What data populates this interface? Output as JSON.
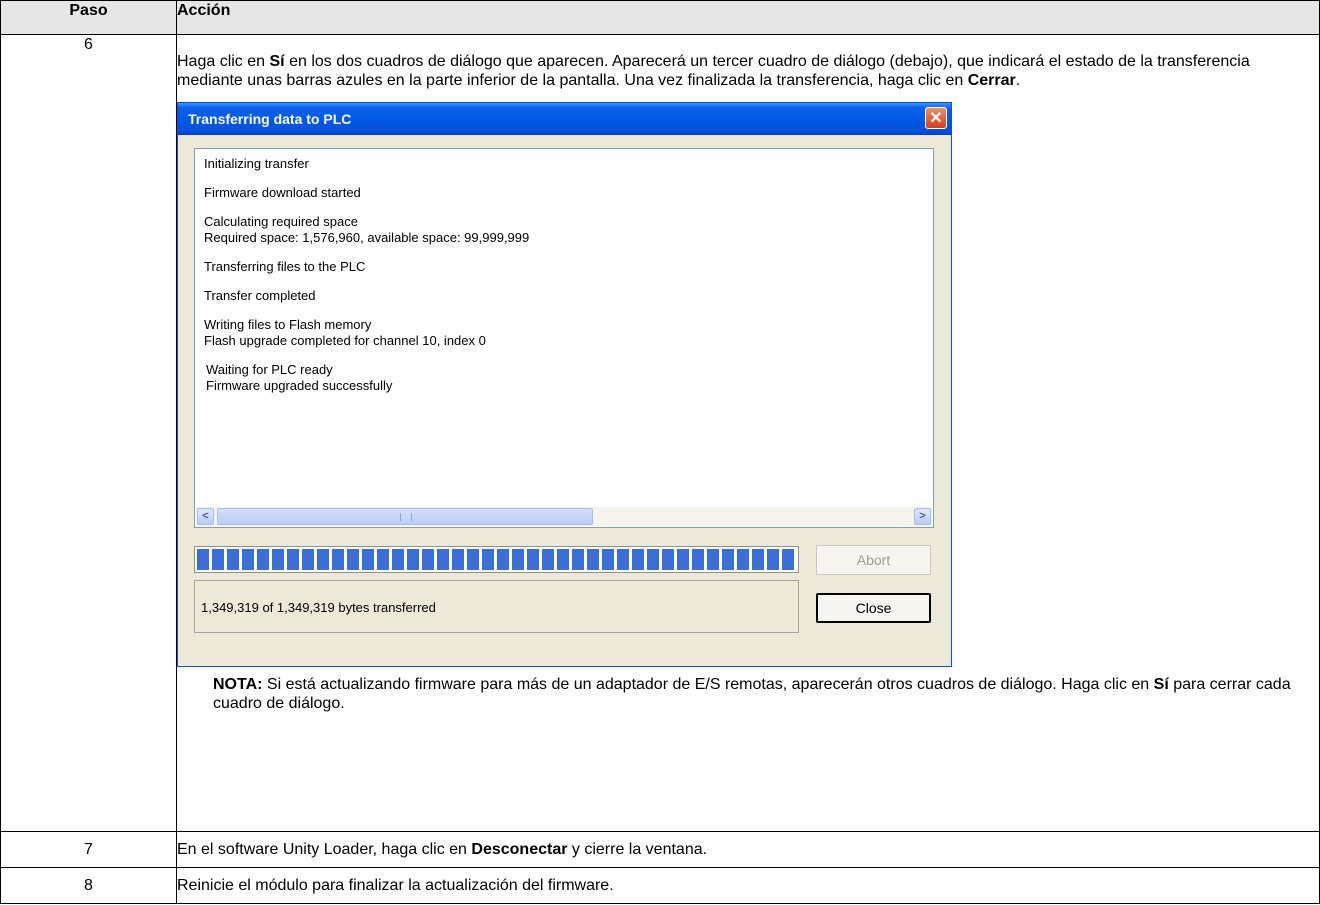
{
  "table": {
    "header": {
      "paso": "Paso",
      "accion": "Acción"
    },
    "step6": {
      "number": "6",
      "intro_a": "Haga clic en ",
      "intro_bold1": "Sí",
      "intro_b": " en los dos cuadros de diálogo que aparecen. Aparecerá un tercer cuadro de diálogo (debajo), que indicará el estado de la transferencia mediante unas barras azules en la parte inferior de la pantalla. Una vez finalizada la transferencia, haga clic en ",
      "intro_bold2": "Cerrar",
      "intro_c": ".",
      "note_label": "NOTA:",
      "note_a": " Si está actualizando firmware para más de un adaptador de E/S remotas, aparecerán otros cuadros de diálogo. Haga clic en ",
      "note_bold": "Sí",
      "note_b": " para cerrar cada cuadro de diálogo."
    },
    "step7": {
      "number": "7",
      "text_a": "En el software Unity Loader, haga clic en ",
      "text_bold": "Desconectar",
      "text_b": " y cierre la ventana."
    },
    "step8": {
      "number": "8",
      "text": "Reinicie el módulo para finalizar la actualización del firmware."
    }
  },
  "dialog": {
    "title": "Transferring data to PLC",
    "close_icon": "close-icon",
    "log": {
      "l1": "Initializing transfer",
      "l2": "Firmware download started",
      "l3": "Calculating required space",
      "l4": "Required space: 1,576,960, available space: 99,999,999",
      "l5": "Transferring files to the PLC",
      "l6": "Transfer completed",
      "l7": "Writing files to Flash memory",
      "l8": "Flash upgrade completed for channel 10, index 0",
      "l9": "Waiting for PLC ready",
      "l10": "Firmware upgraded successfully"
    },
    "progress_fraction": 1.0,
    "status": "1,349,319 of 1,349,319 bytes transferred",
    "abort_label": "Abort",
    "close_label": "Close",
    "accent_color": "#0058e6",
    "progress_color": "#3b6fd6"
  }
}
